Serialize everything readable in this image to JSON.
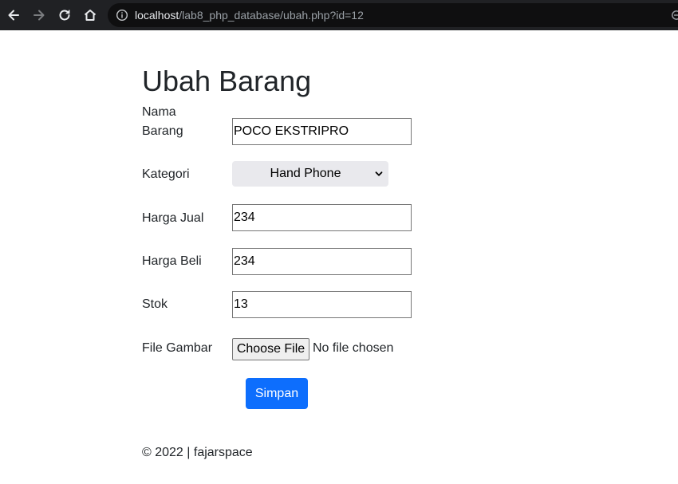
{
  "browser": {
    "url_host": "localhost",
    "url_path": "/lab8_php_database/ubah.php?id=12",
    "back_icon": "arrow-left-icon",
    "forward_icon": "arrow-right-icon",
    "reload_icon": "reload-icon",
    "home_icon": "home-icon",
    "info_icon": "info-icon"
  },
  "page": {
    "title": "Ubah Barang"
  },
  "form": {
    "nama_label_line1": "Nama",
    "nama_label_line2": "Barang",
    "nama_value": "POCO EKSTRIPRO",
    "kategori_label": "Kategori",
    "kategori_value": "Hand Phone",
    "harga_jual_label": "Harga Jual",
    "harga_jual_value": "234",
    "harga_beli_label": "Harga Beli",
    "harga_beli_value": "234",
    "stok_label": "Stok",
    "stok_value": "13",
    "file_label": "File Gambar",
    "file_button_label": "Choose File",
    "file_status": "No file chosen",
    "submit_label": "Simpan"
  },
  "footer": {
    "text": "© 2022 | fajarspace"
  },
  "colors": {
    "primary": "#0d6efd",
    "browser_bar": "#202124"
  }
}
